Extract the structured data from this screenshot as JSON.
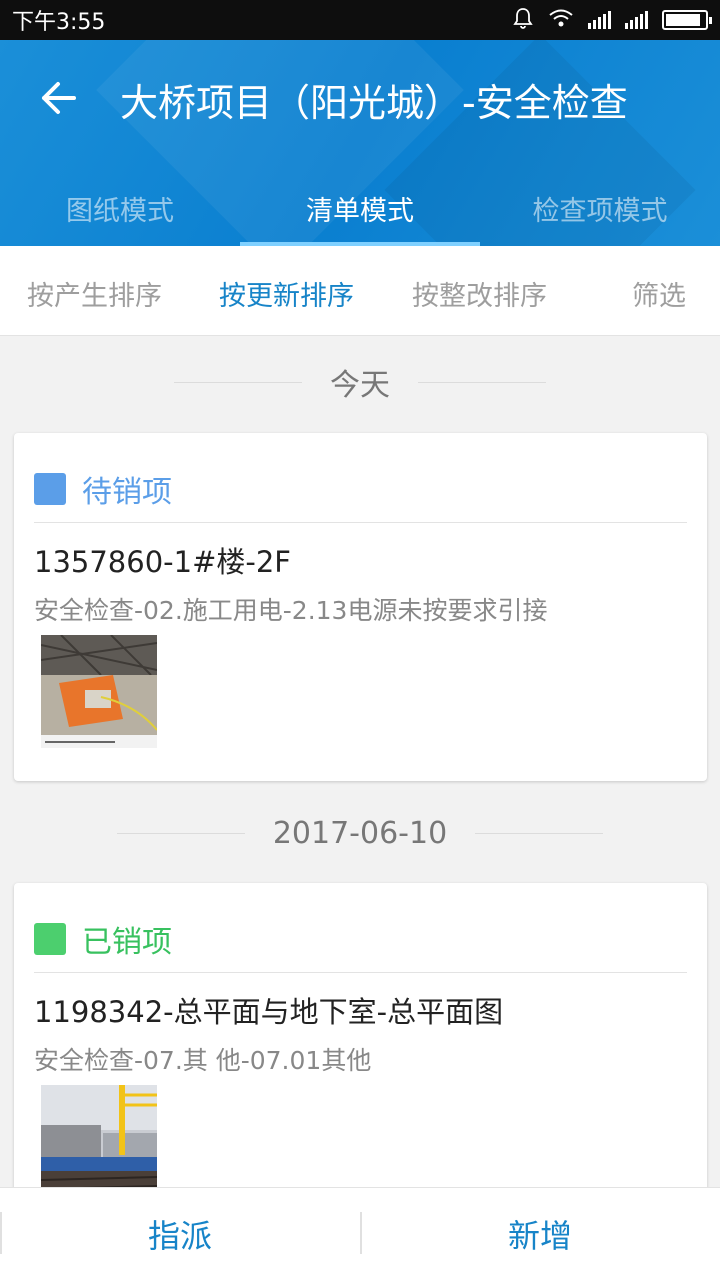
{
  "status_bar": {
    "time": "下午3:55"
  },
  "header": {
    "title": "大桥项目（阳光城）-安全检查",
    "tabs": [
      {
        "label": "图纸模式",
        "active": false
      },
      {
        "label": "清单模式",
        "active": true
      },
      {
        "label": "检查项模式",
        "active": false
      }
    ]
  },
  "sort_bar": {
    "items": [
      {
        "label": "按产生排序",
        "active": false
      },
      {
        "label": "按更新排序",
        "active": true
      },
      {
        "label": "按整改排序",
        "active": false
      }
    ],
    "filter_label": "筛选"
  },
  "groups": [
    {
      "date_label": "今天",
      "card": {
        "status_label": "待销项",
        "status_color": "#5b9ee8",
        "title": "1357860-1#楼-2F",
        "subtitle": "安全检查-02.施工用电-2.13电源未按要求引接"
      }
    },
    {
      "date_label": "2017-06-10",
      "card": {
        "status_label": "已销项",
        "status_color": "#4ccf6e",
        "title": "1198342-总平面与地下室-总平面图",
        "subtitle": "安全检查-07.其 他-07.01其他"
      }
    }
  ],
  "bottom_bar": {
    "assign_label": "指派",
    "add_label": "新增"
  },
  "colors": {
    "primary": "#1784c8",
    "header_bg": "#0a7fd0"
  }
}
